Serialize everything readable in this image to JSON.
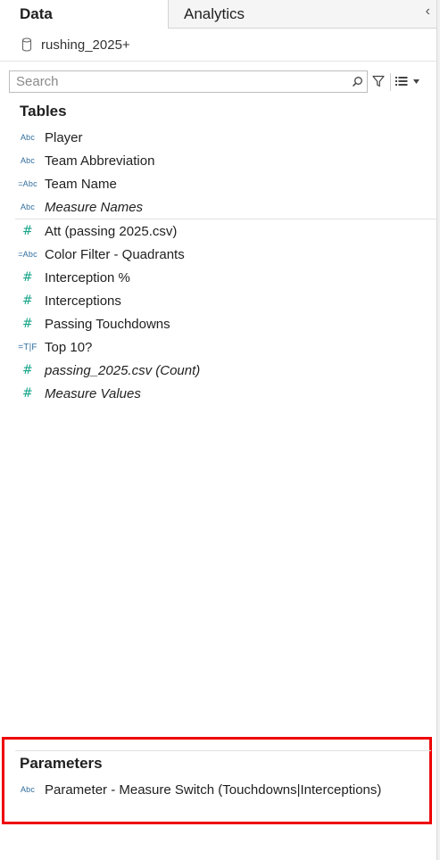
{
  "tabs": {
    "data_label": "Data",
    "analytics_label": "Analytics",
    "collapse_glyph": "‹"
  },
  "datasource": {
    "name": "rushing_2025+",
    "icon": "database-icon"
  },
  "search": {
    "placeholder": "Search",
    "value": ""
  },
  "tables": {
    "title": "Tables",
    "dimensions": [
      {
        "label": "Player",
        "type_icon": "Abc",
        "italic": false
      },
      {
        "label": "Team Abbreviation",
        "type_icon": "Abc",
        "italic": false
      },
      {
        "label": "Team Name",
        "type_icon": "=Abc",
        "italic": false
      },
      {
        "label": "Measure Names",
        "type_icon": "Abc",
        "italic": true
      }
    ],
    "measures": [
      {
        "label": "Att (passing 2025.csv)",
        "type_icon": "#",
        "italic": false
      },
      {
        "label": "Color Filter - Quadrants",
        "type_icon": "=Abc",
        "italic": false
      },
      {
        "label": "Interception %",
        "type_icon": "#",
        "italic": false
      },
      {
        "label": "Interceptions",
        "type_icon": "#",
        "italic": false
      },
      {
        "label": "Passing Touchdowns",
        "type_icon": "#",
        "italic": false
      },
      {
        "label": "Top 10?",
        "type_icon": "=T|F",
        "italic": false
      },
      {
        "label": "passing_2025.csv (Count)",
        "type_icon": "#",
        "italic": true
      },
      {
        "label": "Measure Values",
        "type_icon": "#",
        "italic": true
      }
    ]
  },
  "parameters": {
    "title": "Parameters",
    "items": [
      {
        "label": "Parameter - Measure Switch (Touchdowns|Interceptions)",
        "type_icon": "Abc"
      }
    ]
  },
  "colors": {
    "dimension_icon": "#2f6d9e",
    "measure_icon": "#19a68a",
    "highlight_border": "#ee0000"
  }
}
